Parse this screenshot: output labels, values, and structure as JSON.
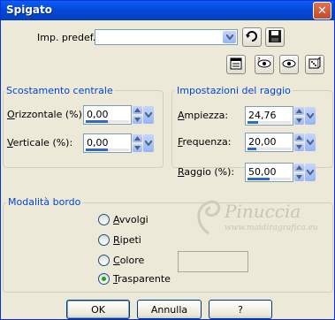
{
  "window": {
    "title": "Spigato"
  },
  "preset": {
    "label": "Imp. predef.:",
    "value": ""
  },
  "group_offset": {
    "title": "Scostamento centrale",
    "horizontal": {
      "label": "Orizzontale (%):",
      "value": "0,00",
      "level": 0.5
    },
    "vertical": {
      "label": "Verticale (%):",
      "value": "0,00",
      "level": 0.5
    }
  },
  "group_ray": {
    "title": "Impostazioni del raggio",
    "amplitude": {
      "label": "Ampiezza:",
      "value": "24,76",
      "level": 0.25
    },
    "frequency": {
      "label": "Frequenza:",
      "value": "20,00",
      "level": 0.2
    },
    "radius": {
      "label": "Raggio (%):",
      "value": "50,00",
      "level": 0.5
    }
  },
  "group_edge": {
    "title": "Modalità bordo",
    "options": [
      {
        "label": "Avvolgi",
        "checked": false
      },
      {
        "label": "Ripeti",
        "checked": false
      },
      {
        "label": "Colore",
        "checked": false
      },
      {
        "label": "Trasparente",
        "checked": true
      }
    ]
  },
  "buttons": {
    "ok": "OK",
    "cancel": "Annulla",
    "help": "?"
  },
  "watermark": {
    "line1": "Pinuccia",
    "line2": "www.maidiragrafica.eu"
  },
  "colors": {
    "title_bar": "#0548d8",
    "accent": "#0046d5",
    "bar_fill": "#2e68c8"
  }
}
